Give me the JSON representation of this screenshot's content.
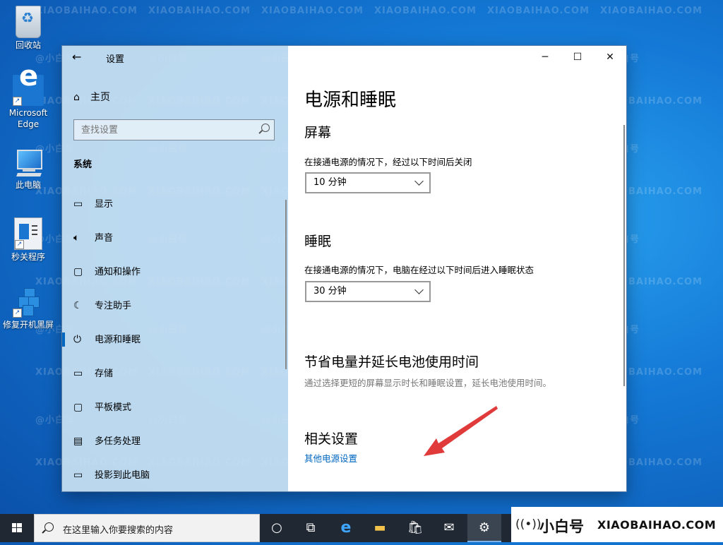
{
  "desktop": {
    "icons": [
      {
        "label": "回收站",
        "icon": "recycle-bin-icon"
      },
      {
        "label": "Microsoft Edge",
        "icon": "edge-icon"
      },
      {
        "label": "此电脑",
        "icon": "this-pc-icon"
      },
      {
        "label": "秒关程序",
        "icon": "program-icon"
      },
      {
        "label": "修复开机黑屏",
        "icon": "repair-icon"
      }
    ],
    "watermark": [
      "XIAOBAIHAO.COM",
      "@小白号"
    ]
  },
  "window": {
    "title": "设置",
    "controls": {
      "minimize": "─",
      "maximize": "☐",
      "close": "✕"
    }
  },
  "sidebar": {
    "home_label": "主页",
    "search_placeholder": "查找设置",
    "section_label": "系统",
    "items": [
      {
        "label": "显示",
        "icon": "display-icon",
        "glyph": "▭"
      },
      {
        "label": "声音",
        "icon": "speaker-icon",
        "glyph": "🔈"
      },
      {
        "label": "通知和操作",
        "icon": "notification-icon",
        "glyph": "▢"
      },
      {
        "label": "专注助手",
        "icon": "moon-icon",
        "glyph": "☾"
      },
      {
        "label": "电源和睡眠",
        "icon": "power-icon",
        "glyph": "⏻",
        "active": true
      },
      {
        "label": "存储",
        "icon": "storage-icon",
        "glyph": "▭"
      },
      {
        "label": "平板模式",
        "icon": "tablet-icon",
        "glyph": "▢"
      },
      {
        "label": "多任务处理",
        "icon": "multitask-icon",
        "glyph": "▤"
      },
      {
        "label": "投影到此电脑",
        "icon": "project-icon",
        "glyph": "▭"
      }
    ]
  },
  "main": {
    "title": "电源和睡眠",
    "screen": {
      "heading": "屏幕",
      "description": "在接通电源的情况下，经过以下时间后关闭",
      "value": "10 分钟"
    },
    "sleep": {
      "heading": "睡眠",
      "description": "在接通电源的情况下，电脑在经过以下时间后进入睡眠状态",
      "value": "30 分钟"
    },
    "battery": {
      "heading": "节省电量并延长电池使用时间",
      "description": "通过选择更短的屏幕显示时长和睡眠设置，延长电池使用时间。"
    },
    "related": {
      "heading": "相关设置",
      "link": "其他电源设置"
    },
    "annotation_color": "#e03a3a"
  },
  "taskbar": {
    "search_placeholder": "在这里输入你要搜索的内容",
    "icons": [
      "windows-start-icon",
      "cortana-icon",
      "task-view-icon",
      "edge-icon",
      "file-explorer-icon",
      "store-icon",
      "mail-icon",
      "settings-icon"
    ]
  },
  "brand": {
    "cn": "小白号",
    "en": "XIAOBAIHAO.COM"
  }
}
